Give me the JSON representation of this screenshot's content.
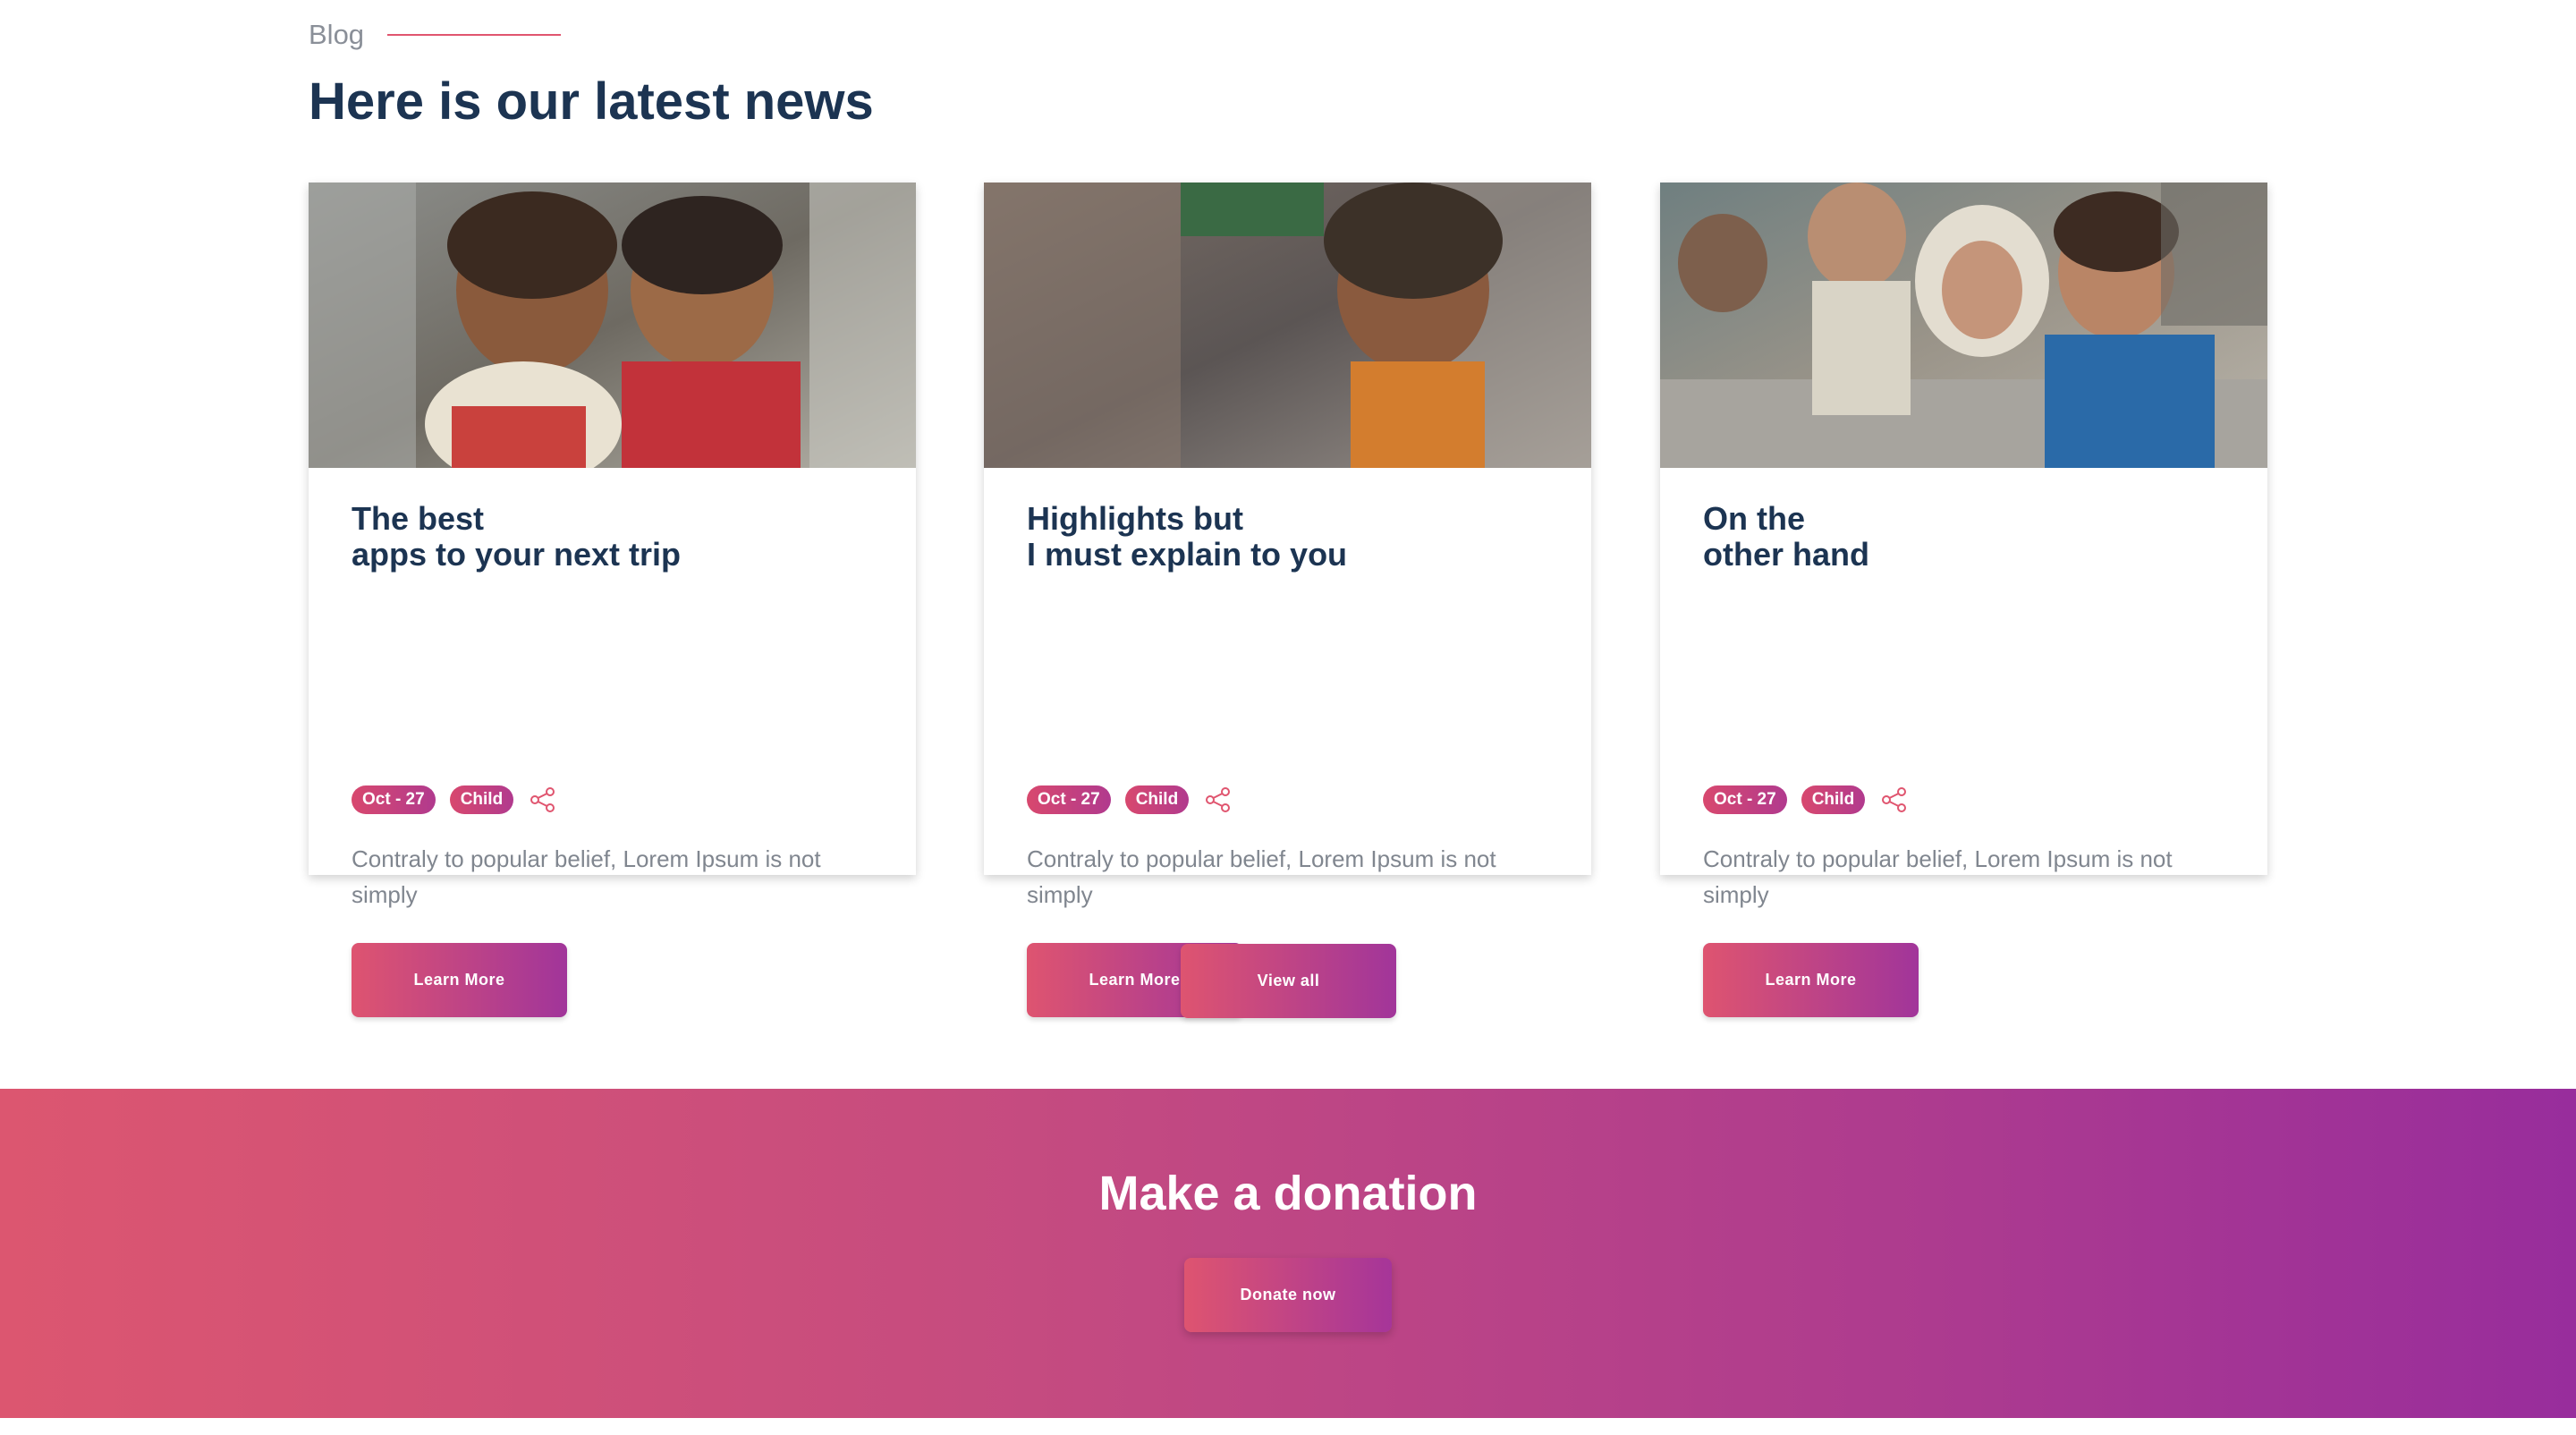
{
  "section": {
    "label": "Blog"
  },
  "heading": "Here is our latest news",
  "cards": [
    {
      "title": "The best\napps to your next trip",
      "date": "Oct - 27",
      "tag": "Child",
      "description": "Contraly to popular belief, Lorem Ipsum is not simply",
      "button": "Learn More"
    },
    {
      "title": "Highlights but\nI must explain to you",
      "date": "Oct - 27",
      "tag": "Child",
      "description": "Contraly to popular belief, Lorem Ipsum is not simply",
      "button": "Learn More"
    },
    {
      "title": "On the\nother hand",
      "date": "Oct - 27",
      "tag": "Child",
      "description": "Contraly to popular belief, Lorem Ipsum is not simply",
      "button": "Learn More"
    }
  ],
  "view_all": "View all",
  "donation": {
    "title": "Make a donation",
    "button": "Donate now"
  },
  "icons": {
    "share": "share-icon"
  },
  "colors": {
    "accent_start": "#de5470",
    "accent_end": "#982d9c",
    "heading": "#1c3452",
    "body_text": "#80868f"
  }
}
